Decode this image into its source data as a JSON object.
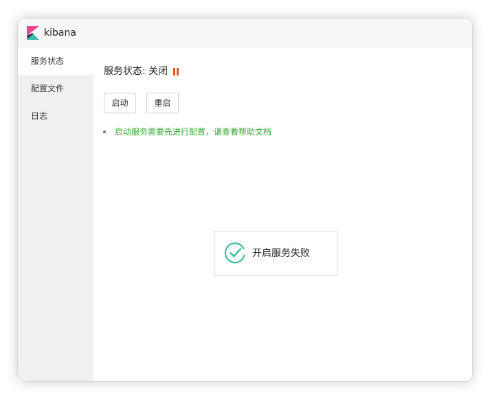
{
  "app": {
    "title": "kibana",
    "logo_icon": "kibana-logo-icon",
    "logo_colors": {
      "top": "#e8478b",
      "bottom": "#3ebeb0",
      "dark": "#343741"
    }
  },
  "sidebar": {
    "items": [
      {
        "label": "服务状态",
        "active": true
      },
      {
        "label": "配置文件",
        "active": false
      },
      {
        "label": "日志",
        "active": false
      }
    ]
  },
  "main": {
    "status_label": "服务状态: 关闭",
    "status_icon": "pause-icon",
    "status_color": "#f0521e",
    "buttons": {
      "start": "启动",
      "restart": "重启"
    },
    "hint": "启动服务需要先进行配置，请查看帮助文档",
    "hint_color": "#3aa838"
  },
  "toast": {
    "icon": "success-check-icon",
    "icon_color": "#3ebf9e",
    "message": "开启服务失败"
  }
}
